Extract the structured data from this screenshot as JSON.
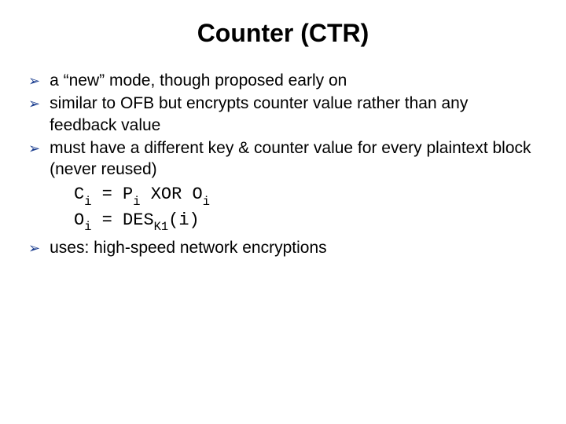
{
  "title": "Counter (CTR)",
  "bullets": {
    "b1": "a “new” mode, though proposed early on",
    "b2": "similar to OFB but encrypts counter value rather than any feedback value",
    "b3": "must have a different key & counter value for every plaintext block (never reused)",
    "b4": "uses: high-speed network encryptions"
  },
  "formula": {
    "c": "C",
    "i1": "i",
    "eq1": " = P",
    "i2": "i",
    "xor": " XOR O",
    "i3": "i",
    "o": "O",
    "i4": "i",
    "eq2": " = DES",
    "k1": "K1",
    "iparen": "(i)"
  }
}
